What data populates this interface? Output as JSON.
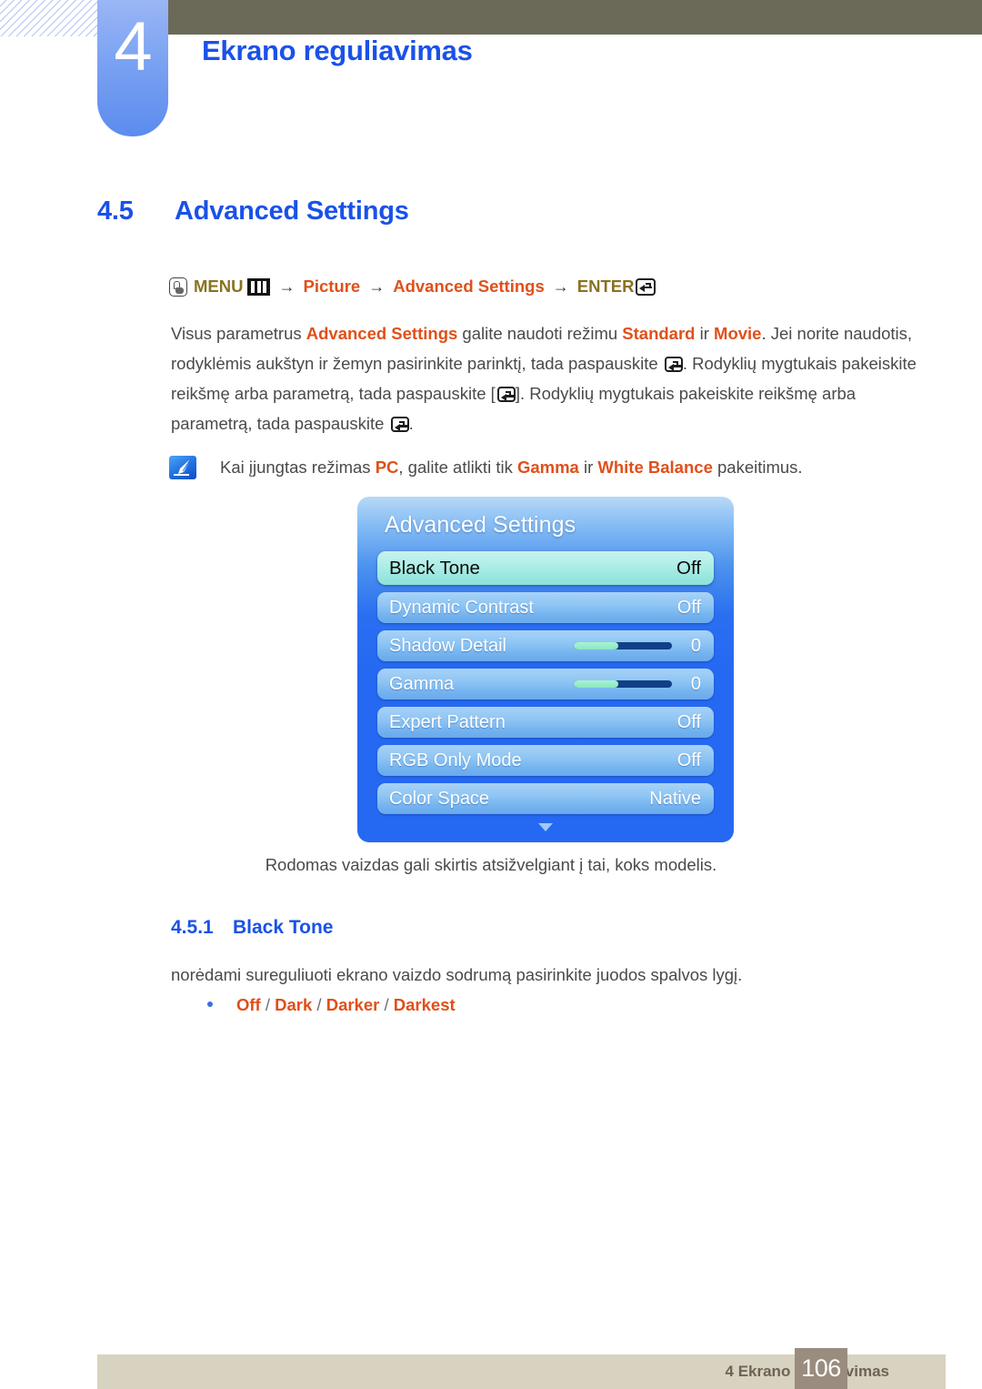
{
  "header": {
    "chapter_number": "4",
    "chapter_title": "Ekrano reguliavimas"
  },
  "section": {
    "number": "4.5",
    "title": "Advanced Settings"
  },
  "breadcrumb": {
    "menu_label": "MENU",
    "arrow": "→",
    "item_picture": "Picture",
    "item_advanced": "Advanced Settings",
    "enter_label": "ENTER",
    "hand_icon": "hand-press-icon",
    "menu_bars_icon": "menu-bars-icon",
    "enter_icon": "enter-key-icon"
  },
  "paragraph": {
    "p1_a": "Visus parametrus ",
    "p1_hl1": "Advanced Settings",
    "p1_b": " galite naudoti režimu ",
    "p1_hl2": "Standard",
    "p1_c": " ir ",
    "p1_hl3": "Movie",
    "p1_d": ". Jei norite naudotis, rodyklėmis aukštyn ir žemyn pasirinkite parinktį, tada paspauskite ",
    "p1_e": ". Rodyklių mygtukais pakeiskite reikšmę arba parametrą, tada paspauskite [",
    "p1_f": "]. Rodyklių mygtukais pakeiskite reikšmę arba parametrą, tada paspauskite ",
    "p1_g": "."
  },
  "note": {
    "icon": "pen-note-icon",
    "a": "Kai įjungtas režimas ",
    "hl1": "PC",
    "b": ", galite atlikti tik ",
    "hl2": "Gamma",
    "c": " ir ",
    "hl3": "White Balance",
    "d": " pakeitimus."
  },
  "osd": {
    "title": "Advanced Settings",
    "rows": [
      {
        "label": "Black Tone",
        "value": "Off",
        "type": "value",
        "selected": true
      },
      {
        "label": "Dynamic Contrast",
        "value": "Off",
        "type": "value",
        "selected": false
      },
      {
        "label": "Shadow Detail",
        "value": "0",
        "type": "slider",
        "fill": 45,
        "selected": false
      },
      {
        "label": "Gamma",
        "value": "0",
        "type": "slider",
        "fill": 45,
        "selected": false
      },
      {
        "label": "Expert Pattern",
        "value": "Off",
        "type": "value",
        "selected": false
      },
      {
        "label": "RGB Only Mode",
        "value": "Off",
        "type": "value",
        "selected": false
      },
      {
        "label": "Color Space",
        "value": "Native",
        "type": "value",
        "selected": false
      }
    ],
    "scroll_icon": "chevron-down-icon",
    "caption": "Rodomas vaizdas gali skirtis atsižvelgiant į tai, koks modelis."
  },
  "subsection": {
    "number": "4.5.1",
    "title": "Black Tone",
    "description": "norėdami sureguliuoti ekrano vaizdo sodrumą pasirinkite juodos spalvos lygį.",
    "options": [
      "Off",
      "Dark",
      "Darker",
      "Darkest"
    ],
    "options_text": "Off / Dark / Darker / Darkest"
  },
  "footer": {
    "label": "4 Ekrano reguliavimas",
    "page": "106"
  },
  "colors": {
    "accent_blue": "#1a52e8",
    "highlight_orange": "#e0501a",
    "menu_olive": "#8a7320",
    "header_olive": "#6b6a58",
    "footer_beige": "#d8d2c0",
    "footer_page_box": "#9a8c7e",
    "osd_blue": "#2569f3",
    "osd_selected": "#9ce8e0"
  }
}
